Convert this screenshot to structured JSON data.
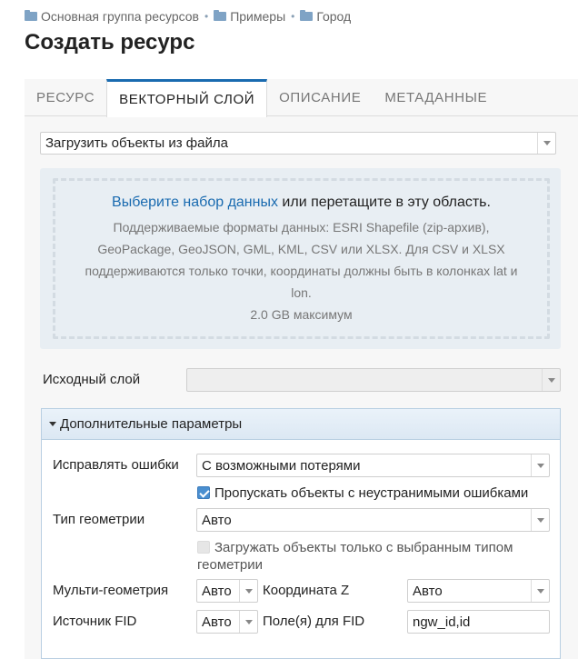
{
  "breadcrumb": [
    {
      "label": "Основная группа ресурсов"
    },
    {
      "label": "Примеры"
    },
    {
      "label": "Город"
    }
  ],
  "page_title": "Создать ресурс",
  "tabs": [
    {
      "label": "Ресурс",
      "active": false
    },
    {
      "label": "Векторный слой",
      "active": true
    },
    {
      "label": "Описание",
      "active": false
    },
    {
      "label": "Метаданные",
      "active": false
    }
  ],
  "source_mode": {
    "value": "Загрузить объекты из файла"
  },
  "dropzone": {
    "link_text": "Выберите набор данных",
    "main_text": " или перетащите в эту область.",
    "supported_formats": "Поддерживаемые форматы данных: ESRI Shapefile (zip-архив), GeoPackage, GeoJSON, GML, KML, CSV или XLSX. Для CSV и XLSX поддерживаются только точки, координаты должны быть в колонках lat и lon.",
    "max_size": "2.0 GB максимум"
  },
  "source_layer": {
    "label": "Исходный слой",
    "value": ""
  },
  "advanced": {
    "title": "Дополнительные параметры",
    "fix_errors": {
      "label": "Исправлять ошибки",
      "value": "С возможными потерями"
    },
    "skip_errors": {
      "label": "Пропускать объекты с неустранимыми ошибками",
      "checked": true
    },
    "geometry_type": {
      "label": "Тип геометрии",
      "value": "Авто"
    },
    "only_selected_type": {
      "label": "Загружать объекты только с выбранным типом геометрии",
      "checked": false
    },
    "multi_geometry": {
      "label": "Мульти-геометрия",
      "value": "Авто"
    },
    "coordinate_z": {
      "label": "Координата Z",
      "value": "Авто"
    },
    "fid_source": {
      "label": "Источник FID",
      "value": "Авто"
    },
    "fid_fields": {
      "label": "Поле(я) для FID",
      "value": "ngw_id,id"
    }
  },
  "colors": {
    "accent": "#1a6bb0",
    "checkbox": "#4a8fd0"
  }
}
